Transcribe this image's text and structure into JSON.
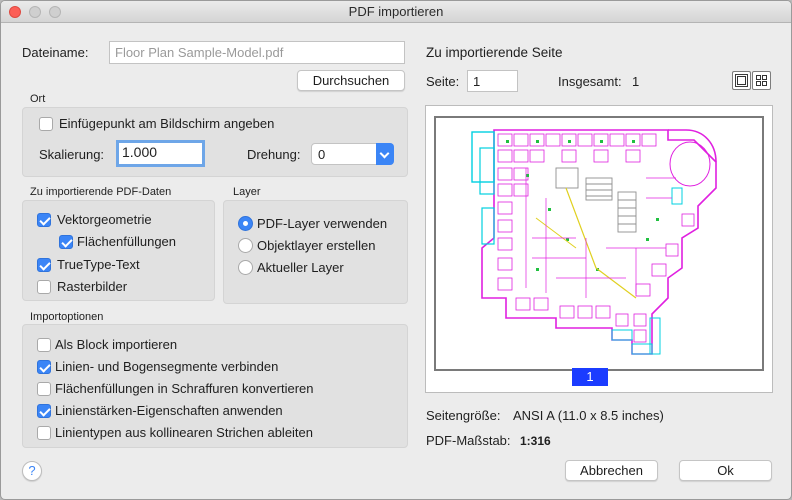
{
  "window": {
    "title": "PDF importieren"
  },
  "file": {
    "label": "Dateiname:",
    "value": "Floor Plan Sample-Model.pdf",
    "browse_label": "Durchsuchen"
  },
  "ort": {
    "heading": "Ort",
    "insertion_label": "Einfügepunkt am Bildschirm angeben",
    "insertion_checked": false,
    "scale_label": "Skalierung:",
    "scale_value": "1.000",
    "rotation_label": "Drehung:",
    "rotation_value": "0"
  },
  "pdf_data": {
    "heading": "Zu importierende PDF-Daten",
    "items": [
      {
        "label": "Vektorgeometrie",
        "checked": true
      },
      {
        "label": "Flächenfüllungen",
        "checked": true
      },
      {
        "label": "TrueType-Text",
        "checked": true
      },
      {
        "label": "Rasterbilder",
        "checked": false
      }
    ]
  },
  "layer": {
    "heading": "Layer",
    "options": [
      {
        "label": "PDF-Layer verwenden",
        "selected": true
      },
      {
        "label": "Objektlayer erstellen",
        "selected": false
      },
      {
        "label": "Aktueller Layer",
        "selected": false
      }
    ]
  },
  "import_options": {
    "heading": "Importoptionen",
    "items": [
      {
        "label": "Als Block importieren",
        "checked": false
      },
      {
        "label": "Linien- und Bogensegmente verbinden",
        "checked": true
      },
      {
        "label": "Flächenfüllungen in Schraffuren konvertieren",
        "checked": false
      },
      {
        "label": "Linienstärken-Eigenschaften anwenden",
        "checked": true
      },
      {
        "label": "Linientypen aus kollinearen Strichen ableiten",
        "checked": false
      }
    ]
  },
  "page_select": {
    "heading": "Zu importierende Seite",
    "page_label": "Seite:",
    "page_value": "1",
    "total_label": "Insgesamt:",
    "total_value": "1",
    "preview_page_number": "1"
  },
  "page_info": {
    "size_label": "Seitengröße:",
    "size_value": "ANSI A (11.0 x 8.5 inches)",
    "scale_label": "PDF-Maßstab:",
    "scale_value": "1:316"
  },
  "footer": {
    "help_symbol": "?",
    "cancel_label": "Abbrechen",
    "ok_label": "Ok"
  },
  "colors": {
    "accent": "#3b85f6",
    "page_badge": "#1b3cff",
    "plan_magenta": "#e020e0",
    "plan_cyan": "#00d0e0",
    "plan_green": "#20c040",
    "plan_yellow": "#e0d020",
    "plan_gray": "#909090"
  }
}
